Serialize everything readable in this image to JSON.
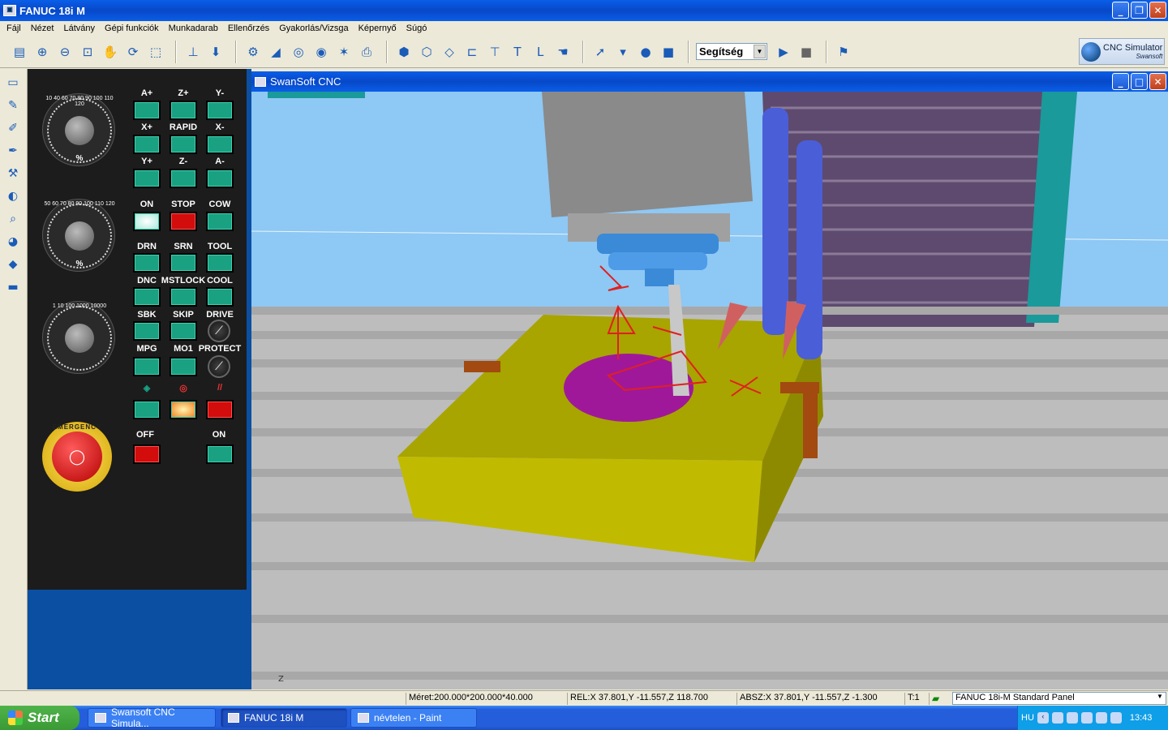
{
  "window": {
    "title": "FANUC 18i M",
    "controls": [
      "_",
      "❐",
      "✕"
    ]
  },
  "menu": [
    "Fájl",
    "Nézet",
    "Látvány",
    "Gépi funkciók",
    "Munkadarab",
    "Ellenőrzés",
    "Gyakorlás/Vizsga",
    "Képernyő",
    "Súgó"
  ],
  "toolbar": {
    "help_combo": "Segítség",
    "logo_line1": "CNC Simulator",
    "logo_line2": "Swansoft"
  },
  "panel": {
    "dial_feed": {
      "unit": "%",
      "numbers": "10 40 60 70 80 90 100 110 120"
    },
    "dial_spindle": {
      "unit": "%",
      "numbers": "50 60 70 80 90 100 110 120"
    },
    "dial_jog": {
      "numbers": "1 10 100 1000 10000"
    },
    "axis_labels": [
      "A+",
      "Z+",
      "Y-",
      "X+",
      "RAPID",
      "X-",
      "Y+",
      "Z-",
      "A-"
    ],
    "row1": [
      "ON",
      "STOP",
      "COW"
    ],
    "row2": [
      "DRN",
      "SRN",
      "TOOL"
    ],
    "row3": [
      "DNC",
      "MSTLOCK",
      "COOL"
    ],
    "row4": [
      "SBK",
      "SKIP",
      "DRIVE"
    ],
    "row5": [
      "MPG",
      "MO1",
      "PROTECT"
    ],
    "power_off": "OFF",
    "power_on": "ON",
    "emergency": "EMERGENCY"
  },
  "child": {
    "title": "SwanSoft CNC"
  },
  "status": {
    "size": "Méret:200.000*200.000*40.000",
    "rel": "REL:X  37.801,Y -11.557,Z 118.700",
    "abs": "ABSZ:X  37.801,Y -11.557,Z  -1.300",
    "tool": "T:1",
    "panel_select": "FANUC 18i-M Standard Panel"
  },
  "taskbar": {
    "start": "Start",
    "tasks": [
      "Swansoft CNC Simula...",
      "FANUC 18i M",
      "névtelen - Paint"
    ],
    "lang": "HU",
    "time": "13:43"
  },
  "colors": {
    "xp_blue": "#0a5ee8",
    "panel_bg": "#1c1c1c",
    "button_teal": "#1aa182",
    "button_red": "#d30c0c",
    "workpiece": "#a8a400",
    "sky": "#8ec8f4"
  }
}
